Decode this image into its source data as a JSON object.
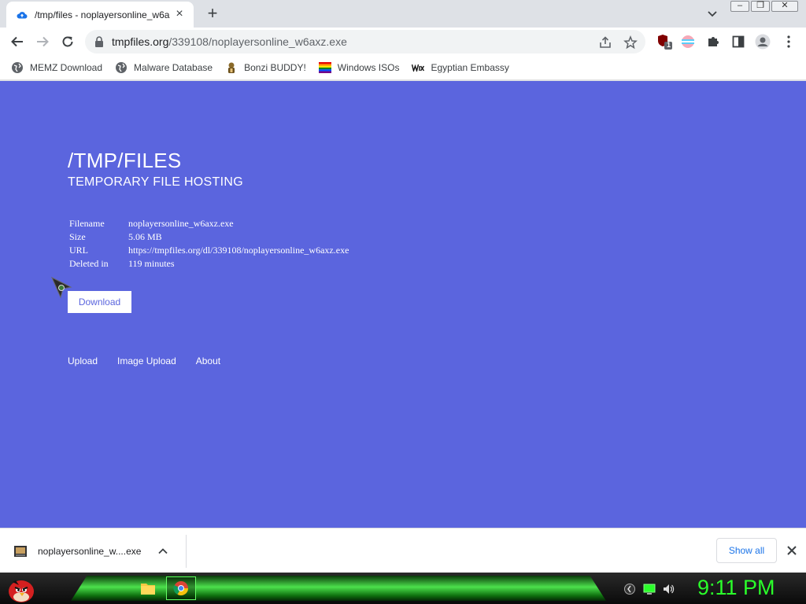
{
  "browser": {
    "tab": {
      "title": "/tmp/files - noplayersonline_w6a"
    },
    "address": {
      "domain": "tmpfiles.org",
      "path": "/339108/noplayersonline_w6axz.exe"
    },
    "extension_badge": "1"
  },
  "bookmarks": [
    {
      "label": "MEMZ Download",
      "icon": "globe-icon"
    },
    {
      "label": "Malware Database",
      "icon": "globe-icon"
    },
    {
      "label": "Bonzi BUDDY!",
      "icon": "bonzi-icon"
    },
    {
      "label": "Windows ISOs",
      "icon": "rainbow-flag-icon"
    },
    {
      "label": "Egyptian Embassy",
      "icon": "wix-icon"
    }
  ],
  "page": {
    "background": "#5b65de",
    "title": "/TMP/FILES",
    "subtitle": "TEMPORARY FILE HOSTING",
    "info": [
      {
        "key": "Filename",
        "value": "noplayersonline_w6axz.exe"
      },
      {
        "key": "Size",
        "value": "5.06 MB"
      },
      {
        "key": "URL",
        "value": "https://tmpfiles.org/dl/339108/noplayersonline_w6axz.exe"
      },
      {
        "key": "Deleted in",
        "value": "119 minutes"
      }
    ],
    "download_label": "Download",
    "footer_links": [
      "Upload",
      "Image Upload",
      "About"
    ]
  },
  "download_shelf": {
    "file_name": "noplayersonline_w....exe",
    "show_all_label": "Show all"
  },
  "taskbar": {
    "clock": "9:11 PM"
  }
}
